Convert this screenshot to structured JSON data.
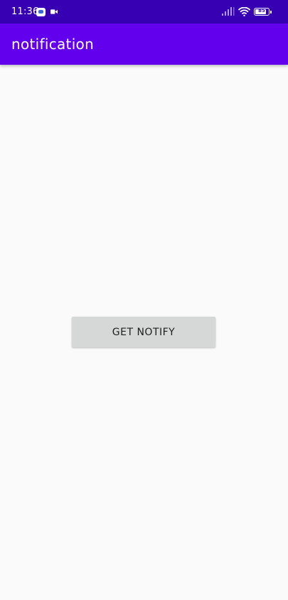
{
  "status_bar": {
    "time": "11:36",
    "battery_level": "85",
    "battery_fill": 0.85,
    "background_color": "#3700b3",
    "icons": [
      "message-icon",
      "video-icon",
      "signal-icon",
      "wifi-icon",
      "battery-icon"
    ]
  },
  "app_bar": {
    "title": "notification",
    "background_color": "#6200ee"
  },
  "main": {
    "button_label": "GET NOTIFY",
    "button_color": "#d6d7d7",
    "background_color": "#fafafa"
  }
}
